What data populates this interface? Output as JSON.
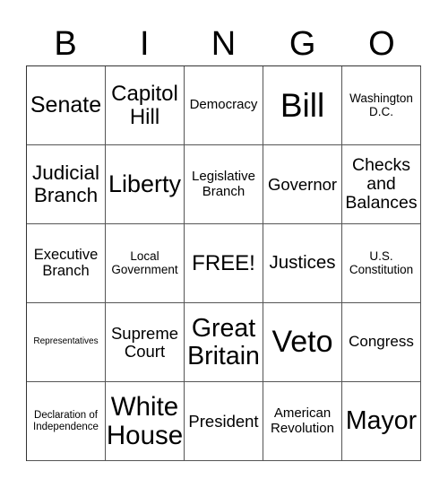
{
  "header": {
    "letters": [
      "B",
      "I",
      "N",
      "G",
      "O"
    ]
  },
  "card": {
    "rows": [
      [
        "Senate",
        "Capitol\nHill",
        "Democracy",
        "Bill",
        "Washington\nD.C."
      ],
      [
        "Judicial\nBranch",
        "Liberty",
        "Legislative\nBranch",
        "Governor",
        "Checks\nand\nBalances"
      ],
      [
        "Executive\nBranch",
        "Local\nGovernment",
        "FREE!",
        "Justices",
        "U.S.\nConstitution"
      ],
      [
        "Representatives",
        "Supreme\nCourt",
        "Great\nBritain",
        "Veto",
        "Congress"
      ],
      [
        "Declaration of\nIndependence",
        "White\nHouse",
        "President",
        "American\nRevolution",
        "Mayor"
      ]
    ],
    "free_space_label": "FREE!"
  }
}
